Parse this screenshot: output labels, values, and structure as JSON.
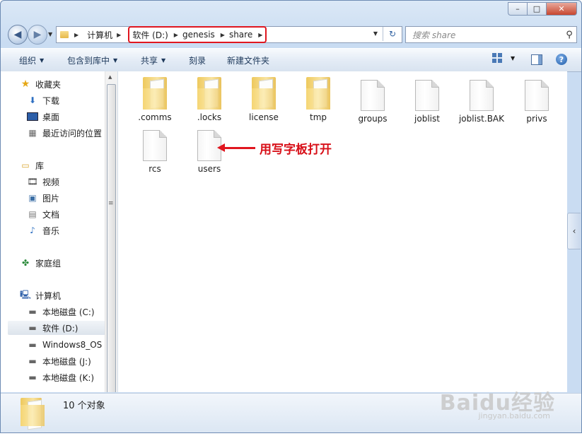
{
  "window": {
    "minimize_label": "–",
    "maximize_label": "□",
    "close_label": "✕"
  },
  "address": {
    "crumbs_plain": [
      "计算机"
    ],
    "crumbs_highlight": [
      "软件 (D:)",
      "genesis",
      "share"
    ]
  },
  "search": {
    "placeholder": "搜索 share"
  },
  "toolbar": {
    "organize": "组织",
    "include_in_library": "包含到库中",
    "share": "共享",
    "burn": "刻录",
    "new_folder": "新建文件夹"
  },
  "nav_pane": {
    "favorites": "收藏夹",
    "downloads": "下载",
    "desktop": "桌面",
    "recent": "最近访问的位置",
    "libraries": "库",
    "videos": "视频",
    "pictures": "图片",
    "documents": "文档",
    "music": "音乐",
    "homegroup": "家庭组",
    "computer": "计算机",
    "drive_c": "本地磁盘 (C:)",
    "drive_d": "软件 (D:)",
    "drive_os": "Windows8_OS (",
    "drive_j": "本地磁盘 (J:)",
    "drive_k": "本地磁盘 (K:)"
  },
  "files": [
    {
      "name": ".comms",
      "type": "folder"
    },
    {
      "name": ".locks",
      "type": "folder"
    },
    {
      "name": "license",
      "type": "folder"
    },
    {
      "name": "tmp",
      "type": "folder"
    },
    {
      "name": "groups",
      "type": "file"
    },
    {
      "name": "joblist",
      "type": "file"
    },
    {
      "name": "joblist.BAK",
      "type": "file"
    },
    {
      "name": "privs",
      "type": "file"
    },
    {
      "name": "rcs",
      "type": "file"
    },
    {
      "name": "users",
      "type": "file"
    }
  ],
  "annotation": {
    "text": "用写字板打开"
  },
  "details": {
    "count_text": "10 个对象"
  },
  "watermark": {
    "brand": "Baidu经验",
    "url": "jingyan.baidu.com"
  },
  "colors": {
    "highlight": "#e0161f",
    "accent": "#1e395b"
  }
}
